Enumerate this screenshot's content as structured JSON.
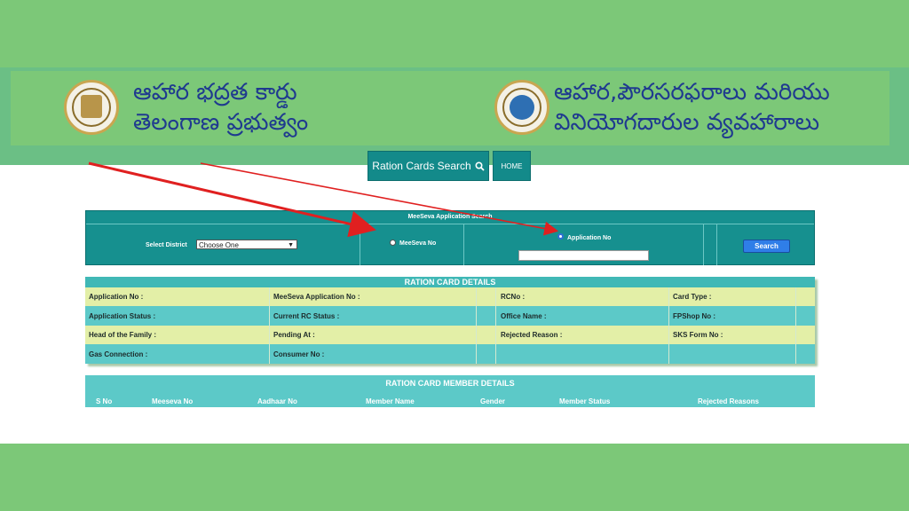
{
  "header": {
    "left_title_line1": "ఆహార భద్రత కార్డు",
    "left_title_line2": "తెలంగాణ ప్రభుత్వం",
    "right_title_line1": "ఆహార,పౌరసరఫరాలు మరియు",
    "right_title_line2": "వినియోగదారుల వ్యవహారాలు"
  },
  "nav": {
    "ration_search_label": "Ration Cards Search",
    "home_label": "HOME"
  },
  "search_panel": {
    "title": "MeeSeva Application Search",
    "district_label": "Select District",
    "district_value": "Choose One",
    "meeseva_label": "MeeSeva No",
    "application_label": "Application No",
    "application_input_value": "",
    "search_button": "Search"
  },
  "details": {
    "title": "RATION CARD DETAILS",
    "rows": [
      [
        "Application No :",
        "MeeSeva Application No :",
        "RCNo :",
        "Card Type :"
      ],
      [
        "Application Status :",
        "Current RC Status :",
        "Office Name :",
        "FPShop No :"
      ],
      [
        "Head of the Family :",
        "Pending At :",
        "Rejected Reason :",
        "SKS Form No :"
      ],
      [
        "Gas Connection :",
        "Consumer No :",
        "",
        ""
      ]
    ]
  },
  "members": {
    "title": "RATION CARD MEMBER DETAILS",
    "columns": [
      "S No",
      "Meeseva No",
      "Aadhaar No",
      "Member Name",
      "Gender",
      "Member Status",
      "Rejected Reasons"
    ]
  },
  "colors": {
    "page_green": "#7cc878",
    "teal": "#16908f",
    "arrow_red": "#e02020",
    "title_blue": "#1f3a8f"
  }
}
